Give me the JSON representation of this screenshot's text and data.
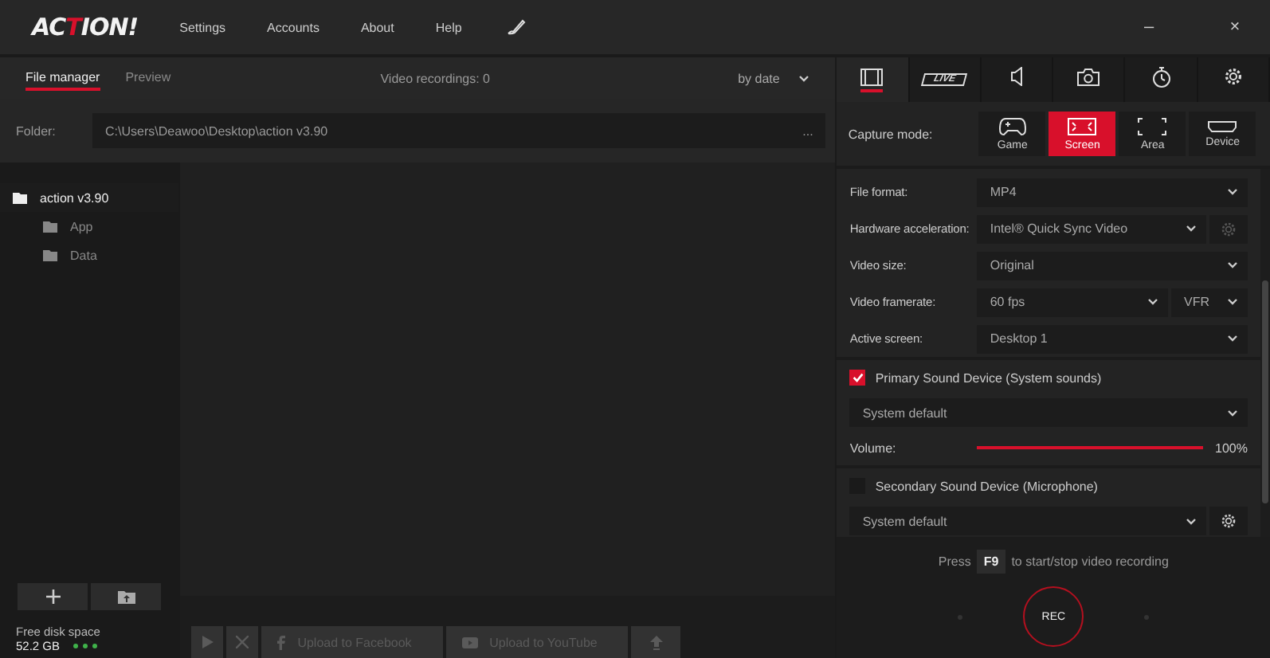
{
  "title_bar": {
    "logo_parts": [
      {
        "text": "AC",
        "accent": false
      },
      {
        "text": "T",
        "accent": true
      },
      {
        "text": "ION!",
        "accent": false
      }
    ],
    "menu": [
      "Settings",
      "Accounts",
      "About",
      "Help"
    ],
    "minimize": "–",
    "close": "×"
  },
  "file_panel": {
    "tabs": [
      {
        "label": "File manager",
        "selected": true
      },
      {
        "label": "Preview",
        "selected": false
      }
    ],
    "recordings": "Video recordings: 0",
    "sort": "by date",
    "folder_label": "Folder:",
    "folder_path": "C:\\Users\\Deawoo\\Desktop\\action v3.90",
    "folder_more": "...",
    "tree": [
      {
        "label": "action v3.90",
        "selected": true,
        "children": [
          {
            "label": "App",
            "selected": false
          },
          {
            "label": "Data",
            "selected": false
          }
        ]
      }
    ],
    "free_disk_label": "Free disk space",
    "free_disk_value": "52.2 GB",
    "toolbar": [
      {
        "kind": "play"
      },
      {
        "kind": "delete"
      },
      {
        "kind": "facebook",
        "label": "Upload to Facebook"
      },
      {
        "kind": "youtube",
        "label": "Upload to YouTube"
      },
      {
        "kind": "upload"
      }
    ]
  },
  "settings_panel": {
    "tabs": [
      {
        "kind": "video",
        "selected": true
      },
      {
        "kind": "live",
        "label": "LIVE",
        "selected": false
      },
      {
        "kind": "audio",
        "selected": false
      },
      {
        "kind": "camera",
        "selected": false
      },
      {
        "kind": "timer",
        "selected": false
      },
      {
        "kind": "settings",
        "selected": false
      }
    ],
    "capture_label": "Capture mode:",
    "capture_modes": [
      {
        "kind": "game",
        "label": "Game",
        "selected": false
      },
      {
        "kind": "screen",
        "label": "Screen",
        "selected": true
      },
      {
        "kind": "area",
        "label": "Area",
        "selected": false
      },
      {
        "kind": "device",
        "label": "Device",
        "selected": false
      }
    ],
    "rows": [
      {
        "kind": "select",
        "label": "File format:",
        "value": "MP4"
      },
      {
        "kind": "select_gear",
        "label": "Hardware acceleration:",
        "value": "Intel® Quick Sync Video"
      },
      {
        "kind": "select",
        "label": "Video size:",
        "value": "Original"
      },
      {
        "kind": "select_pair",
        "label": "Video framerate:",
        "value": "60 fps",
        "value2": "VFR"
      },
      {
        "kind": "select",
        "label": "Active screen:",
        "value": "Desktop 1"
      }
    ],
    "primary_sound": {
      "label": "Primary Sound Device (System sounds)",
      "checked": true,
      "device": "System default",
      "volume_label": "Volume:",
      "level": 1,
      "reading": "100%"
    },
    "secondary_sound": {
      "label": "Secondary Sound Device (Microphone)",
      "checked": false,
      "device": "System default"
    },
    "hotkey": {
      "prefix": "Press",
      "key": "F9",
      "suffix": "to start/stop video recording"
    },
    "rec": "REC"
  }
}
